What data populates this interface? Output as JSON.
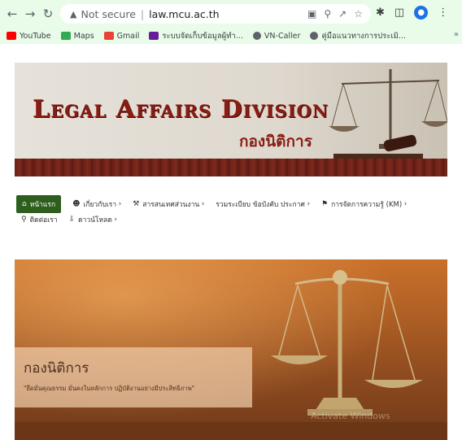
{
  "browser": {
    "url_status": "Not secure",
    "url": "law.mcu.ac.th",
    "bookmarks": [
      {
        "label": "YouTube",
        "color": "#ff0000"
      },
      {
        "label": "Maps",
        "color": "#34a853"
      },
      {
        "label": "Gmail",
        "color": "#ea4335"
      },
      {
        "label": "ระบบจัดเก็บข้อมูลผู้ทำ...",
        "color": "#6a1b9a"
      },
      {
        "label": "VN-Caller",
        "color": "#5f6368"
      },
      {
        "label": "คู่มือแนวทางการประเมิ...",
        "color": "#5f6368"
      }
    ],
    "bookmarks_more": "»"
  },
  "banner": {
    "title": "Legal Affairs Division",
    "subtitle_thai": "กองนิติการ"
  },
  "menu": {
    "row1": [
      {
        "label": "หน้าแรก",
        "icon": "home-icon",
        "active": true
      },
      {
        "label": "เกี่ยวกับเรา",
        "icon": "group-icon",
        "has_sub": true
      },
      {
        "label": "สารสนเทศส่วนงาน",
        "icon": "wrench-icon",
        "has_sub": true
      },
      {
        "label": "รวมระเบียบ ข้อบังคับ ประกาศ",
        "icon": "",
        "has_sub": true
      },
      {
        "label": "การจัดการความรู้ (KM)",
        "icon": "graduation-cap-icon",
        "has_sub": true
      }
    ],
    "row2": [
      {
        "label": "ติดต่อเรา",
        "icon": "map-marker-icon"
      },
      {
        "label": "ดาวน์โหลด",
        "icon": "download-icon",
        "has_sub": true
      }
    ]
  },
  "hero": {
    "title": "กองนิติการ",
    "subtitle": "\"ยึดมั่นคุณธรรม มั่นคงในหลักการ ปฏิบัติงานอย่างมีประสิทธิภาพ\"",
    "watermark": "Activate Windows"
  }
}
